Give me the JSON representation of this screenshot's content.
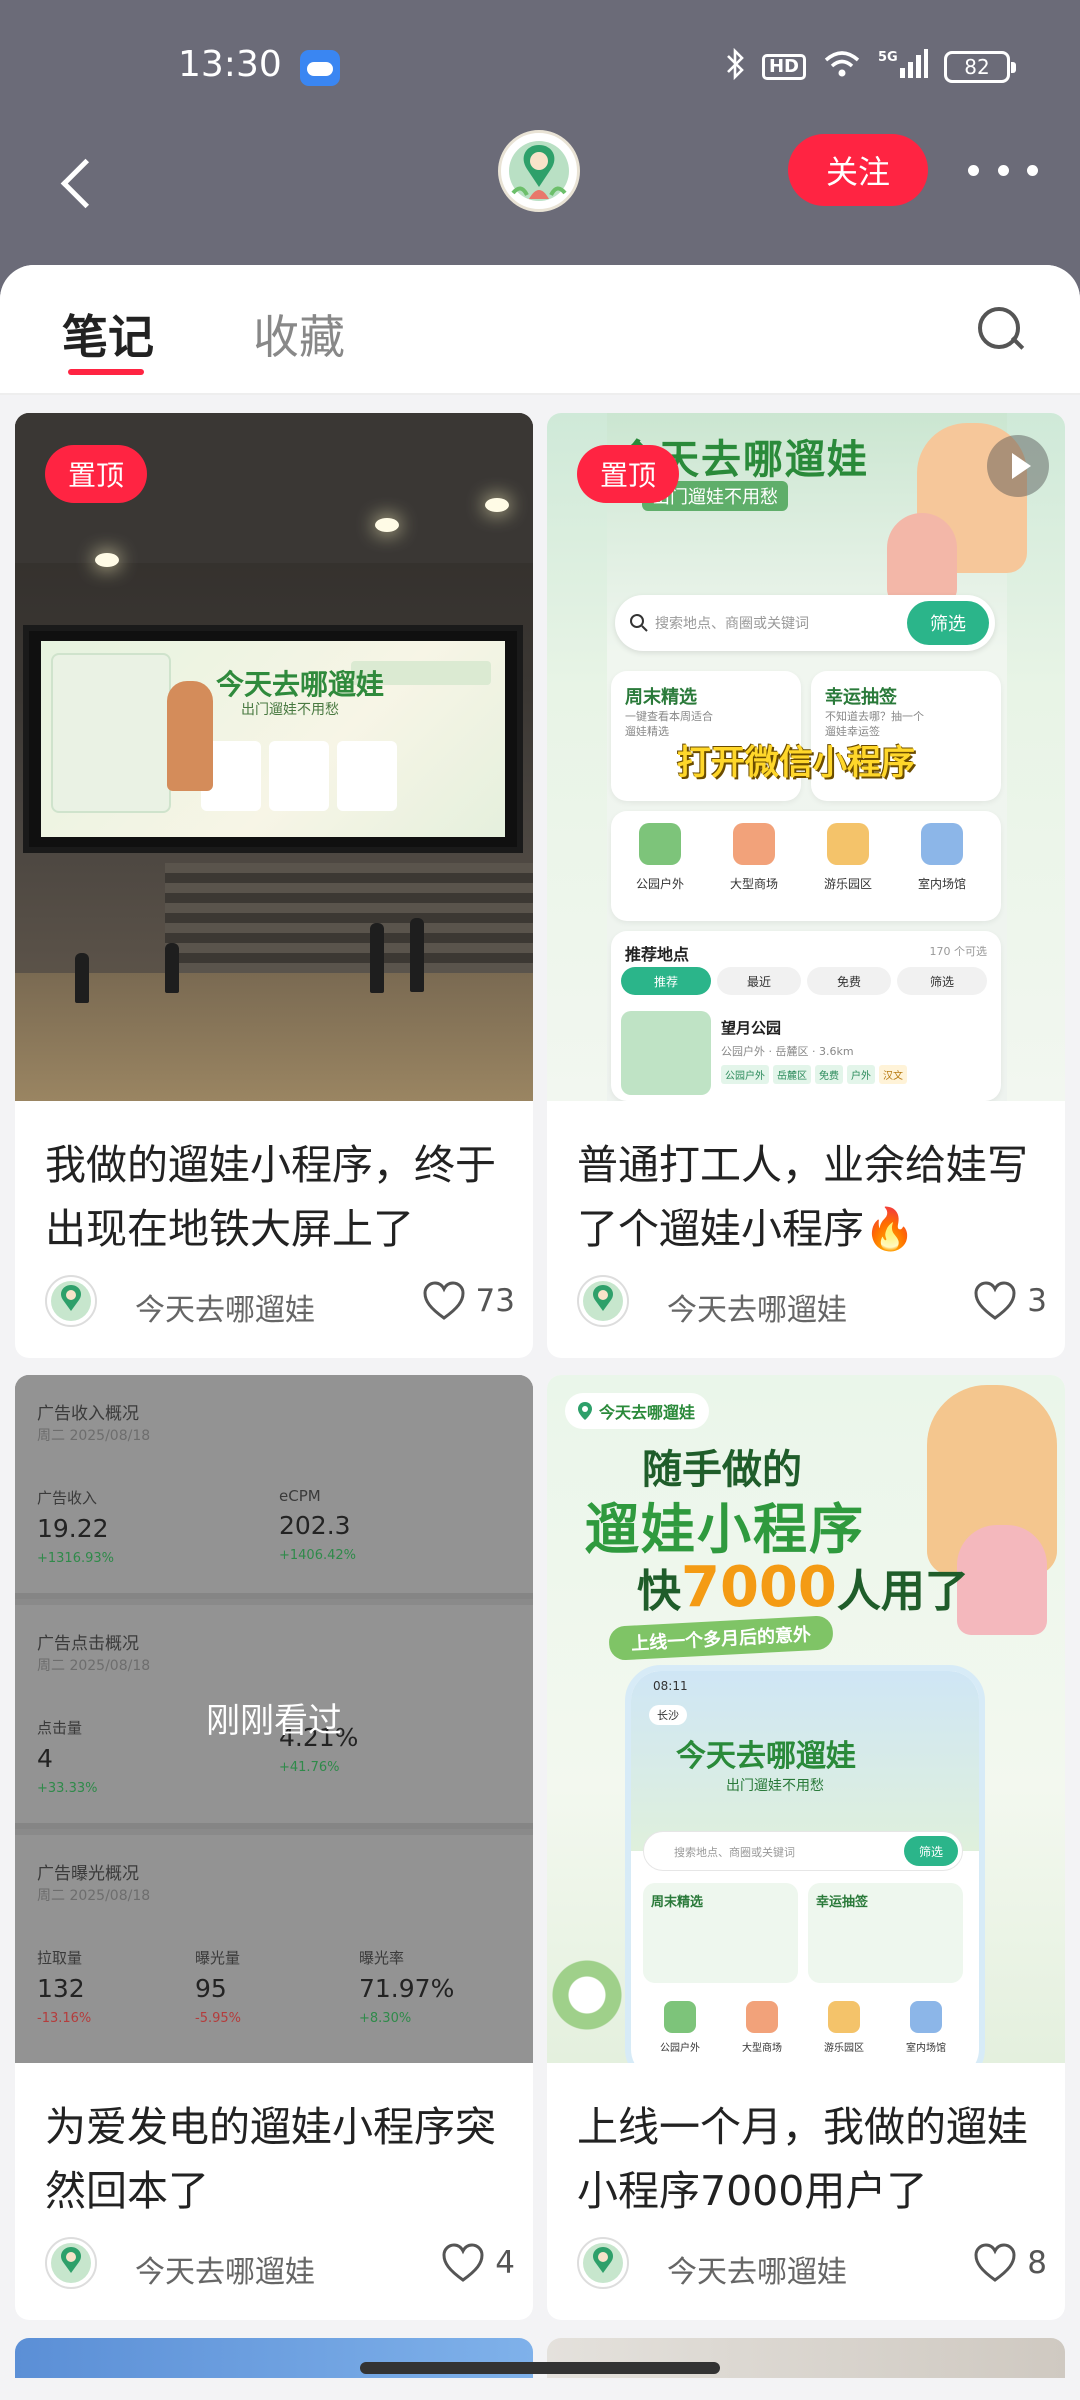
{
  "status_bar": {
    "time": "13:30",
    "network": "5G",
    "battery": "82"
  },
  "nav": {
    "follow_label": "关注"
  },
  "tabs": [
    {
      "label": "笔记",
      "active": true
    },
    {
      "label": "收藏",
      "active": false
    }
  ],
  "accent_color": "#ff2442",
  "notes": [
    {
      "pinned_label": "置顶",
      "title": "我做的遛娃小程序，终于出现在地铁大屏上了",
      "author": "今天去哪遛娃",
      "likes": "73",
      "image": {
        "screen_title": "今天去哪遛娃",
        "screen_subtitle": "出门遛娃不用愁"
      }
    },
    {
      "pinned_label": "置顶",
      "title": "普通打工人，业余给娃写了个遛娃小程序🔥",
      "author": "今天去哪遛娃",
      "likes": "3",
      "image": {
        "app_title": "今天去哪遛娃",
        "app_subtitle": "出门遛娃不用愁",
        "search_placeholder": "搜索地点、商圈或关键词",
        "filter_button": "筛选",
        "card1_title": "周末精选",
        "card1_desc": "一键查看本周适合遛娃精选",
        "card2_title": "幸运抽签",
        "card2_desc": "不知道去哪？抽一个遛娃幸运签",
        "banner": "打开微信小程序",
        "categories": [
          "公园户外",
          "大型商场",
          "游乐园区",
          "室内场馆"
        ],
        "recommend_title": "推荐地点",
        "recommend_count": "170 个可选",
        "chips": [
          "推荐",
          "最近",
          "免费",
          "筛选"
        ],
        "place_name": "望月公园",
        "place_meta": "公园户外 · 岳麓区 · 3.6km",
        "place_tags": [
          "公园户外",
          "岳麓区",
          "免费",
          "户外",
          "汉文"
        ]
      }
    },
    {
      "title": "为爱发电的遛娃小程序突然回本了",
      "author": "今天去哪遛娃",
      "likes": "4",
      "overlay": "刚刚看过",
      "image": {
        "sections": [
          {
            "title": "广告收入概况",
            "date": "周二 2025/08/18",
            "stats": [
              {
                "label": "广告收入",
                "value": "19.22",
                "change": "+1316.93%",
                "trend": "up"
              },
              {
                "label": "eCPM",
                "value": "202.3",
                "change": "+1406.42%",
                "trend": "up"
              }
            ]
          },
          {
            "title": "广告点击概况",
            "date": "周二 2025/08/18",
            "stats": [
              {
                "label": "点击量",
                "value": "4",
                "change": "+33.33%",
                "trend": "up"
              },
              {
                "label": "",
                "value": "4.21%",
                "change": "+41.76%",
                "trend": "up"
              }
            ]
          },
          {
            "title": "广告曝光概况",
            "date": "周二 2025/08/18",
            "stats": [
              {
                "label": "拉取量",
                "value": "132",
                "change": "-13.16%",
                "trend": "down"
              },
              {
                "label": "曝光量",
                "value": "95",
                "change": "-5.95%",
                "trend": "down"
              },
              {
                "label": "曝光率",
                "value": "71.97%",
                "change": "+8.30%",
                "trend": "up"
              }
            ]
          }
        ]
      }
    },
    {
      "title": "上线一个月，我做的遛娃小程序7000用户了",
      "author": "今天去哪遛娃",
      "likes": "8",
      "image": {
        "tag": "今天去哪遛娃",
        "line1": "随手做的",
        "line2": "遛娃小程序",
        "line3_prefix": "快",
        "line3_num": "7000",
        "line3_suffix": "人用了",
        "ribbon": "上线一个多月后的意外",
        "phone_time": "08:11",
        "phone_location": "长沙",
        "phone_title": "今天去哪遛娃",
        "phone_subtitle": "出门遛娃不用愁",
        "phone_search": "搜索地点、商圈或关键词",
        "phone_filter": "筛选",
        "phone_card1": "周末精选",
        "phone_card2": "幸运抽签",
        "phone_categories": [
          "公园户外",
          "大型商场",
          "游乐园区",
          "室内场馆"
        ]
      }
    }
  ]
}
